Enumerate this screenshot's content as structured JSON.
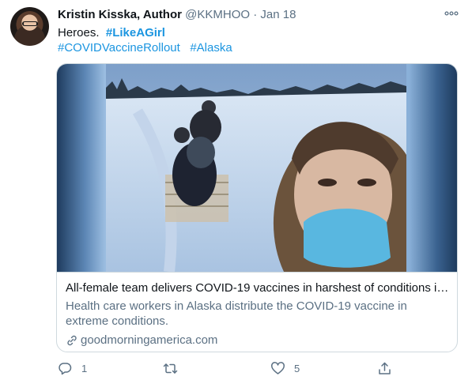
{
  "author": {
    "name": "Kristin Kisska, Author",
    "handle": "@KKMHOO",
    "separator": "·",
    "date": "Jan 18"
  },
  "tweet": {
    "text_plain": "Heroes.",
    "hashtag_1": "#LikeAGirl",
    "hashtag_2": "#COVIDVaccineRollout",
    "hashtag_3": "#Alaska"
  },
  "card": {
    "title": "All-female team delivers COVID-19 vaccines in harshest of conditions in ...",
    "description": "Health care workers in Alaska distribute the COVID-19 vaccine in extreme conditions.",
    "domain": "goodmorningamerica.com"
  },
  "actions": {
    "reply_count": "1",
    "retweet_count": "",
    "like_count": "5"
  },
  "icons": {
    "more": "more-horizontal-icon",
    "reply": "reply-icon",
    "retweet": "retweet-icon",
    "like": "heart-icon",
    "share": "share-icon",
    "link": "link-icon"
  },
  "colors": {
    "link": "#1b95e0",
    "secondary_text": "#5b7083",
    "border": "#cfd9de"
  }
}
